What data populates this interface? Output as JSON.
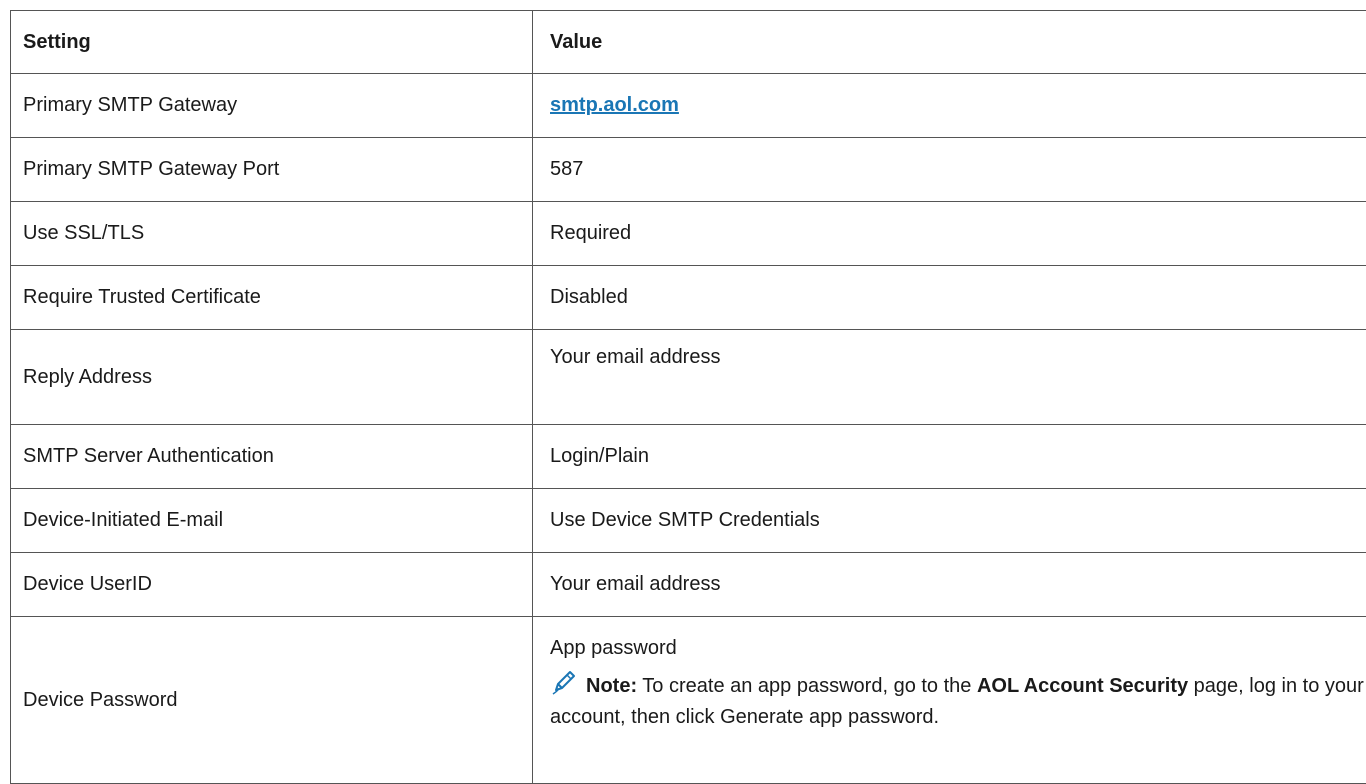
{
  "table": {
    "headers": {
      "setting": "Setting",
      "value": "Value"
    },
    "rows": [
      {
        "setting": "Primary SMTP Gateway",
        "value": "smtp.aol.com"
      },
      {
        "setting": "Primary SMTP Gateway Port",
        "value": "587"
      },
      {
        "setting": "Use SSL/TLS",
        "value": "Required"
      },
      {
        "setting": "Require Trusted Certificate",
        "value": "Disabled"
      },
      {
        "setting": "Reply Address",
        "value": "Your email address"
      },
      {
        "setting": "SMTP Server Authentication",
        "value": "Login/Plain"
      },
      {
        "setting": "Device-Initiated E-mail",
        "value": "Use Device SMTP Credentials"
      },
      {
        "setting": "Device UserID",
        "value": "Your email address"
      },
      {
        "setting": "Device Password",
        "value": "App password",
        "note": {
          "icon": "pencil-icon",
          "label": "Note:",
          "text_before": " To create an app password, go to the ",
          "link_text": "AOL Account Security",
          "text_after": " page, log in to your account, then click Generate app password."
        }
      }
    ]
  },
  "colors": {
    "link": "#1a76b5",
    "border": "#555555",
    "icon": "#1a76b5"
  }
}
